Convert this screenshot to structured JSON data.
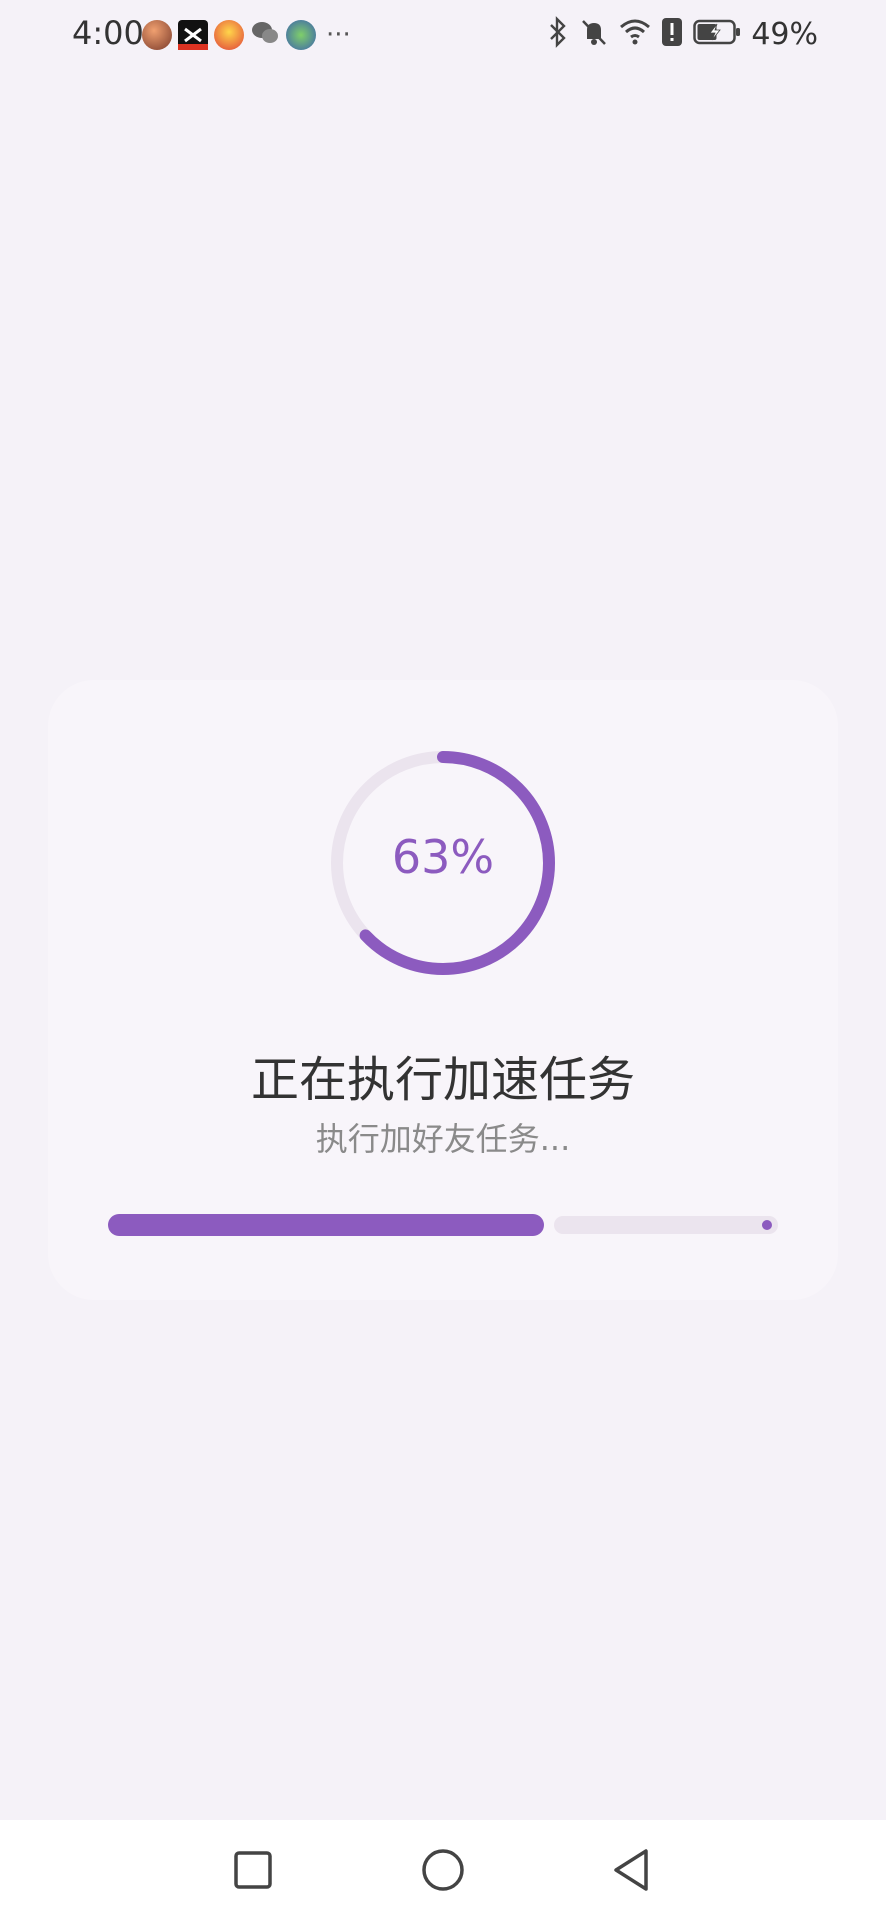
{
  "status_bar": {
    "time": "4:00",
    "more": "···",
    "battery_text": "49%",
    "notification_icons": [
      "app-avatar-icon",
      "capcut-icon",
      "game-icon",
      "wechat-icon",
      "game2-icon"
    ],
    "system_icons": [
      "bluetooth-icon",
      "mute-bell-icon",
      "wifi-icon",
      "alert-icon",
      "battery-charging-icon"
    ]
  },
  "progress": {
    "percent_label": "63%",
    "ring_fraction": 0.63,
    "title": "正在执行加速任务",
    "subtitle": "执行加好友任务...",
    "bar_fraction": 0.65
  },
  "colors": {
    "accent": "#8c5bbf",
    "track": "#ebe4ee",
    "background": "#f5f2f8"
  },
  "nav_bar": {
    "buttons": [
      "recent-apps-button",
      "home-button",
      "back-button"
    ]
  }
}
